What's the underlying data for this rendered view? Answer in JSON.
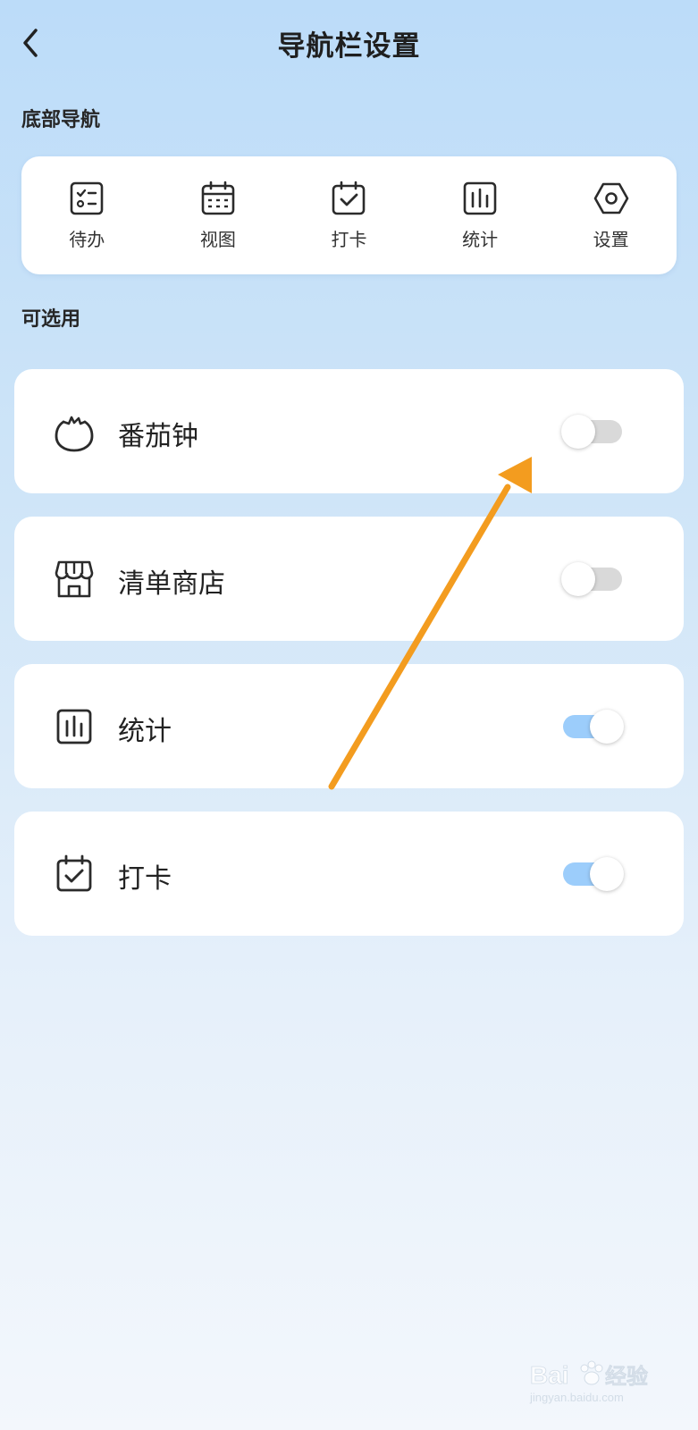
{
  "header": {
    "title": "导航栏设置"
  },
  "bottom_nav": {
    "label": "底部导航",
    "items": [
      {
        "label": "待办",
        "icon": "todo-checklist-icon"
      },
      {
        "label": "视图",
        "icon": "calendar-grid-icon"
      },
      {
        "label": "打卡",
        "icon": "calendar-check-icon"
      },
      {
        "label": "统计",
        "icon": "bar-chart-icon"
      },
      {
        "label": "设置",
        "icon": "hexagon-settings-icon"
      }
    ]
  },
  "optional": {
    "label": "可选用",
    "items": [
      {
        "label": "番茄钟",
        "icon": "tomato-icon",
        "enabled": false
      },
      {
        "label": "清单商店",
        "icon": "store-icon",
        "enabled": false
      },
      {
        "label": "统计",
        "icon": "bar-chart-icon",
        "enabled": true
      },
      {
        "label": "打卡",
        "icon": "calendar-check-icon",
        "enabled": true
      }
    ]
  },
  "colors": {
    "toggle_on": "#9ccdfb",
    "toggle_off": "#d9d9d9",
    "annotation_arrow": "#f39c1f"
  },
  "watermark": {
    "brand": "Bai 经验",
    "url": "jingyan.baidu.com"
  }
}
